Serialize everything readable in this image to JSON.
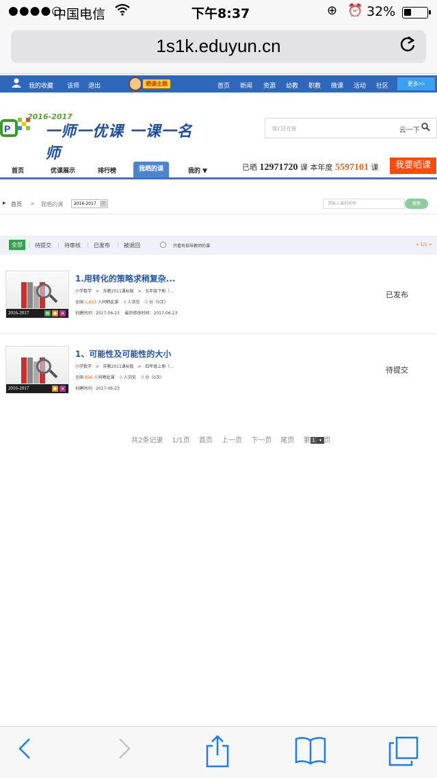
{
  "status_bar": {
    "signal": "●●●●○",
    "carrier": "中国电信",
    "time": "下午8:37",
    "battery": "32%",
    "battery_level": 0.32
  },
  "browser": {
    "url": "1s1k.eduyun.cn",
    "reload_icon": "reload-icon"
  },
  "site_nav": {
    "left_items": [
      "我的收藏",
      "该师",
      "退出"
    ],
    "mascot_label": "晒课主题",
    "right_items": [
      "首页",
      "新闻",
      "资源",
      "幼教",
      "职教",
      "微课",
      "活动",
      "社区"
    ],
    "more": "更多>>"
  },
  "logo": {
    "year": "2016-2017",
    "slogan": "一师一优课 一课一名师"
  },
  "search": {
    "placeholder": "我们正在搜",
    "button": "云一下"
  },
  "tabs": [
    "首页",
    "优课展示",
    "排行榜",
    "我晒的课",
    "我的 ▼"
  ],
  "active_tab": "我晒的课",
  "stats": {
    "prefix": "已晒",
    "total": "12971720",
    "unit1": "课",
    "year_label": "本年度",
    "year_total": "5597101",
    "unit2": "课"
  },
  "share_button": "我要晒课",
  "breadcrumb": {
    "home": "首页",
    "separator": ">",
    "current": "我晒的课",
    "year_select": "2016-2017",
    "search_placeholder": "请输入课例名称",
    "search_button": "搜索"
  },
  "filters": {
    "items": [
      "全部",
      "待提交",
      "待审核",
      "已发布",
      "被退回"
    ],
    "active": "全部",
    "checkbox_label": "只看有指导教师的课",
    "pager": "< 1/1 >"
  },
  "courses": [
    {
      "title": "1.用转化的策略求稍复杂...",
      "subject": "小学数学",
      "edition": "苏教2011课标版",
      "grade": "五年级下册（...",
      "sep": ">",
      "stats_prefix": "全国",
      "shared_count": "1,633",
      "shared_label": "人同晒此课",
      "views": "0",
      "views_label": "人浏览",
      "score": "0",
      "score_label": "分（0次）",
      "created": "创建时间：2017-06-23",
      "modified": "最后修改时间：2017-06-23",
      "thumb_year": "2016-2017",
      "status": "已发布"
    },
    {
      "title": "1、可能性及可能性的大小",
      "subject": "小学数学",
      "edition": "苏教2011课标版",
      "grade": "四年级上册（...",
      "sep": ">",
      "stats_prefix": "全国",
      "shared_count": "856",
      "shared_label": "人同晒此课",
      "views": "0",
      "views_label": "人浏览",
      "score": "0",
      "score_label": "分（0次）",
      "created": "创建时间：2017-06-23",
      "modified": "",
      "thumb_year": "2016-2017",
      "status": "待提交"
    }
  ],
  "pagination": {
    "records": "共2条记录",
    "pages": "1/1页",
    "first": "首页",
    "prev": "上一页",
    "next": "下一页",
    "last": "尾页",
    "goto_prefix": "第",
    "goto_value": "1",
    "goto_suffix": "页"
  },
  "colors": {
    "nav_blue": "#2f67ba",
    "accent_orange": "#f06010",
    "share_red": "#ff4a0c",
    "title_blue": "#1f57a8",
    "filter_green": "#2ea44f"
  }
}
